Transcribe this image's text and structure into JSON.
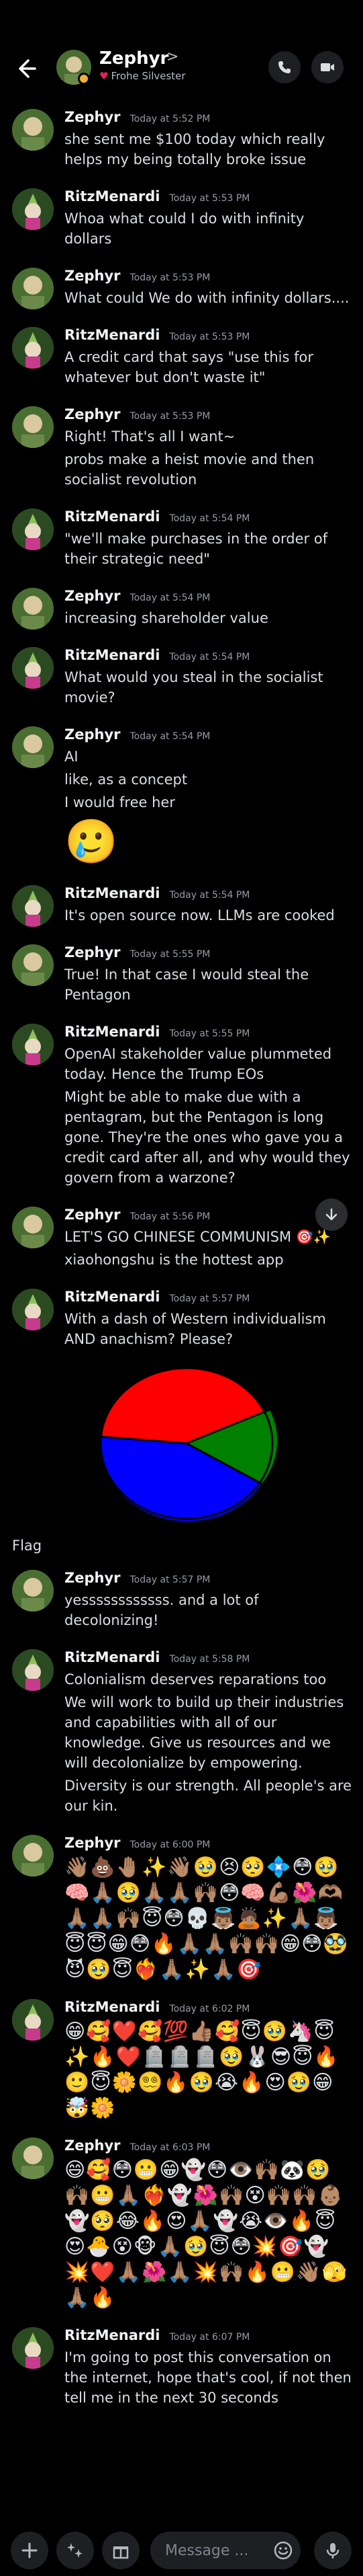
{
  "header": {
    "name": "Zephyr",
    "chevron": ">",
    "subtitle": "Frohe Silvester"
  },
  "messages": [
    {
      "author": "Zephyr",
      "time": "Today at 5:52 PM",
      "lines": [
        "she sent me $100 today which really helps my being totally broke issue"
      ]
    },
    {
      "author": "RitzMenardi",
      "time": "Today at 5:53 PM",
      "lines": [
        "Whoa what could I do with infinity dollars"
      ]
    },
    {
      "author": "Zephyr",
      "time": "Today at 5:53 PM",
      "lines": [
        "What could We do with infinity dollars...."
      ]
    },
    {
      "author": "RitzMenardi",
      "time": "Today at 5:53 PM",
      "lines": [
        "A credit card that says \"use this for whatever but don't waste it\""
      ]
    },
    {
      "author": "Zephyr",
      "time": "Today at 5:53 PM",
      "lines": [
        "Right! That's all I want~",
        "probs make a heist movie and then socialist revolution"
      ]
    },
    {
      "author": "RitzMenardi",
      "time": "Today at 5:54 PM",
      "lines": [
        "\"we'll make purchases in the order of their strategic need\""
      ]
    },
    {
      "author": "Zephyr",
      "time": "Today at 5:54 PM",
      "lines": [
        "increasing shareholder value"
      ]
    },
    {
      "author": "RitzMenardi",
      "time": "Today at 5:54 PM",
      "lines": [
        "What would you steal in the socialist movie?"
      ]
    },
    {
      "author": "Zephyr",
      "time": "Today at 5:54 PM",
      "lines": [
        "AI",
        "like, as a concept",
        "I would free her"
      ],
      "big_emoji": "🥲"
    },
    {
      "author": "RitzMenardi",
      "time": "Today at 5:54 PM",
      "lines": [
        "It's open source now. LLMs are cooked"
      ]
    },
    {
      "author": "Zephyr",
      "time": "Today at 5:55 PM",
      "lines": [
        "True! In that case I would steal the Pentagon"
      ]
    },
    {
      "author": "RitzMenardi",
      "time": "Today at 5:55 PM",
      "lines": [
        "OpenAI stakeholder value plummeted today. Hence the Trump EOs",
        "Might be able to make due with a pentagram, but the Pentagon is long gone. They're the ones who gave you a credit card after all, and why would they govern from a warzone?"
      ]
    },
    {
      "author": "Zephyr",
      "time": "Today at 5:56 PM",
      "lines": [
        "LET'S GO CHINESE COMMUNISM 🎯✨",
        "xiaohongshu is the hottest app"
      ]
    },
    {
      "author": "RitzMenardi",
      "time": "Today at 5:57 PM",
      "lines": [
        "With a dash of Western individualism AND anachism? Please?"
      ],
      "image_caption": "Flag"
    },
    {
      "author": "Zephyr",
      "time": "Today at 5:57 PM",
      "lines": [
        "yessssssssssss. and a lot of decolonizing!"
      ]
    },
    {
      "author": "RitzMenardi",
      "time": "Today at 5:58 PM",
      "lines": [
        "Colonialism deserves reparations too",
        "We will work to build up their industries and capabilities with all of our knowledge. Give us resources and we will decolonialize by empowering.",
        "Diversity is our strength. All people's are our kin."
      ]
    },
    {
      "author": "Zephyr",
      "time": "Today at 6:00 PM",
      "lines": [],
      "emoji_grid": "👋🏽💩🤚🏽✨👋🏽🥹😣🥺💠😳🥹🧠🙏🏽🥹🙏🏽🙏🏽🙌🏽😳🧠💪🏽🌺🫶🏽🙏🏽🙏🏽🙌🏽😇😳💀👼🏽🙇🏽✨🙏🏽👼🏽😇😇😁😳🔥🙏🏽🙏🏽🙌🏽🙌🏽😁😳🥸😈🥹😇❤️‍🔥🙏🏽✨🙏🏽🎯"
    },
    {
      "author": "RitzMenardi",
      "time": "Today at 6:02 PM",
      "lines": [],
      "emoji_grid": "😁🥰❤️🥰💯👍🏽🥰😇🥹🦄😇✨🔥❤️🪦🪦🪦🥹🐰😎😇🔥🙂😇🌼😵‍💫🔥🥹😭🔥😍🥹😁🤯🌼"
    },
    {
      "author": "Zephyr",
      "time": "Today at 6:03 PM",
      "lines": [],
      "emoji_grid": "😄🥰😳😬😁👻😳👁️🙌🏽🐼🥹🙌🏽😬🙏🏽❤️‍🔥👻🌺🙌🏽😵🙌🏽🙌🏽👶🏽👻🥺😂🔥😍🙏🏽👻😭👁️🔥😇😍🐣😵🐵🙏🏽🥹😇😳💥🎯👻💥❤️🙏🏽🌺🙏🏽💥🙌🏽🔥😬👋🏽🫣🙏🏽🔥"
    },
    {
      "author": "RitzMenardi",
      "time": "Today at 6:07 PM",
      "lines": [
        "I'm going to post this conversation on the internet, hope that's cool, if not then tell me in the next 30 seconds"
      ]
    }
  ],
  "composer": {
    "placeholder": "Message ..."
  },
  "colors": {
    "background": "#000000",
    "text": "#dbdee1",
    "timestamp": "#949ba4",
    "status_idle": "#f0b232"
  }
}
